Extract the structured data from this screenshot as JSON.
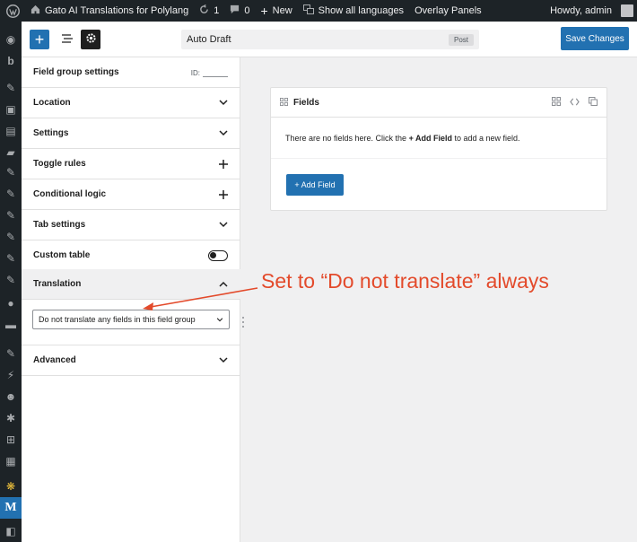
{
  "adminbar": {
    "site_name": "Gato AI Translations for Polylang",
    "updates_count": "1",
    "comments_count": "0",
    "new_label": "New",
    "languages_label": "Show all languages",
    "overlay_label": "Overlay Panels",
    "greeting": "Howdy, admin"
  },
  "toolbar": {
    "title": "Auto Draft",
    "post_type_badge": "Post",
    "save_label": "Save Changes"
  },
  "sidebar": {
    "header": "Field group settings",
    "id_label": "ID:",
    "panels": [
      {
        "label": "Location"
      },
      {
        "label": "Settings"
      },
      {
        "label": "Toggle rules"
      },
      {
        "label": "Conditional logic"
      },
      {
        "label": "Tab settings"
      },
      {
        "label": "Custom table"
      },
      {
        "label": "Translation"
      },
      {
        "label": "Advanced"
      }
    ],
    "translation_select": "Do not translate any fields in this field group"
  },
  "fields_card": {
    "title": "Fields",
    "empty_prefix": "There are no fields here. Click the ",
    "empty_link": "+ Add Field",
    "empty_suffix": " to add a new field.",
    "add_button": "+ Add Field"
  },
  "annotation": {
    "text": "Set to “Do not translate” always",
    "color": "#e34a2b"
  },
  "colors": {
    "accent": "#2271b1",
    "adminbar": "#1d2327"
  }
}
